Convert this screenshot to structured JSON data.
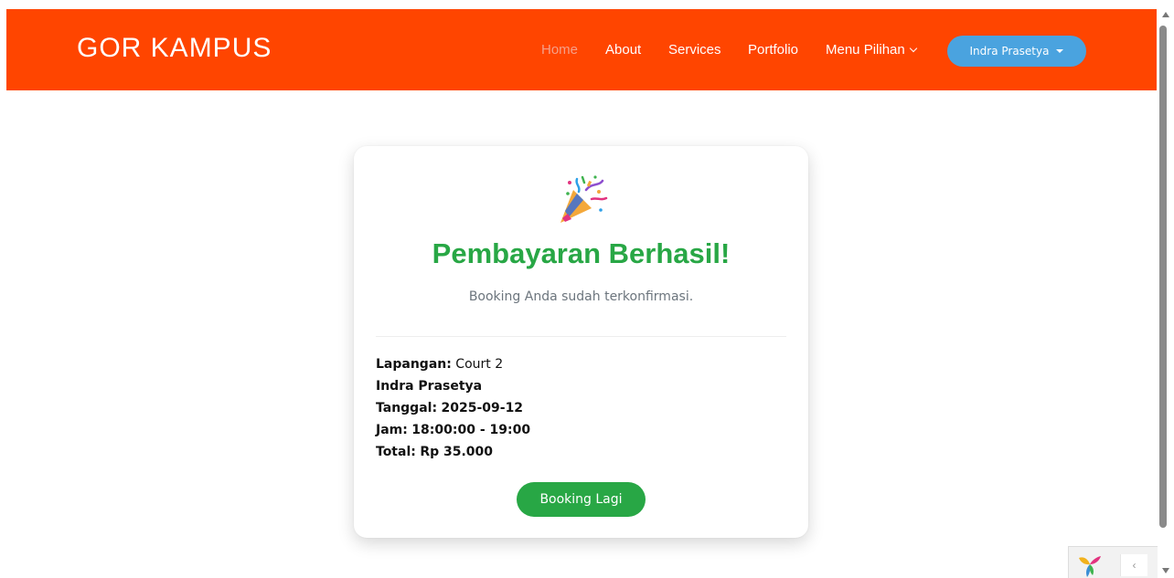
{
  "navbar": {
    "brand": "GOR KAMPUS",
    "links": [
      {
        "label": "Home",
        "active": true
      },
      {
        "label": "About",
        "active": false
      },
      {
        "label": "Services",
        "active": false
      },
      {
        "label": "Portfolio",
        "active": false
      }
    ],
    "dropdown_label": "Menu Pilihan",
    "user_label": "Indra Prasetya",
    "colors": {
      "background": "#ff4500",
      "active_link": "#f5a088",
      "user_button": "#4aa3df"
    }
  },
  "card": {
    "icon": "party-popper-icon",
    "title": "Pembayaran Berhasil!",
    "subtitle": "Booking Anda sudah terkonfirmasi.",
    "details": {
      "court_label": "Lapangan:",
      "court_value": "Court 2",
      "name": "Indra Prasetya",
      "date_label": "Tanggal:",
      "date_value": "2025-09-12",
      "time_label": "Jam:",
      "time_value": "18:00:00 - 19:00",
      "total_label": "Total:",
      "total_value": "Rp 35.000"
    },
    "button_label": "Booking Lagi",
    "colors": {
      "title": "#28a745",
      "button": "#28a745"
    }
  },
  "debug_toolbar": {
    "logo_icon": "yii-logo-icon",
    "toggle_icon": "chevron-left-icon",
    "toggle_glyph": "‹"
  }
}
